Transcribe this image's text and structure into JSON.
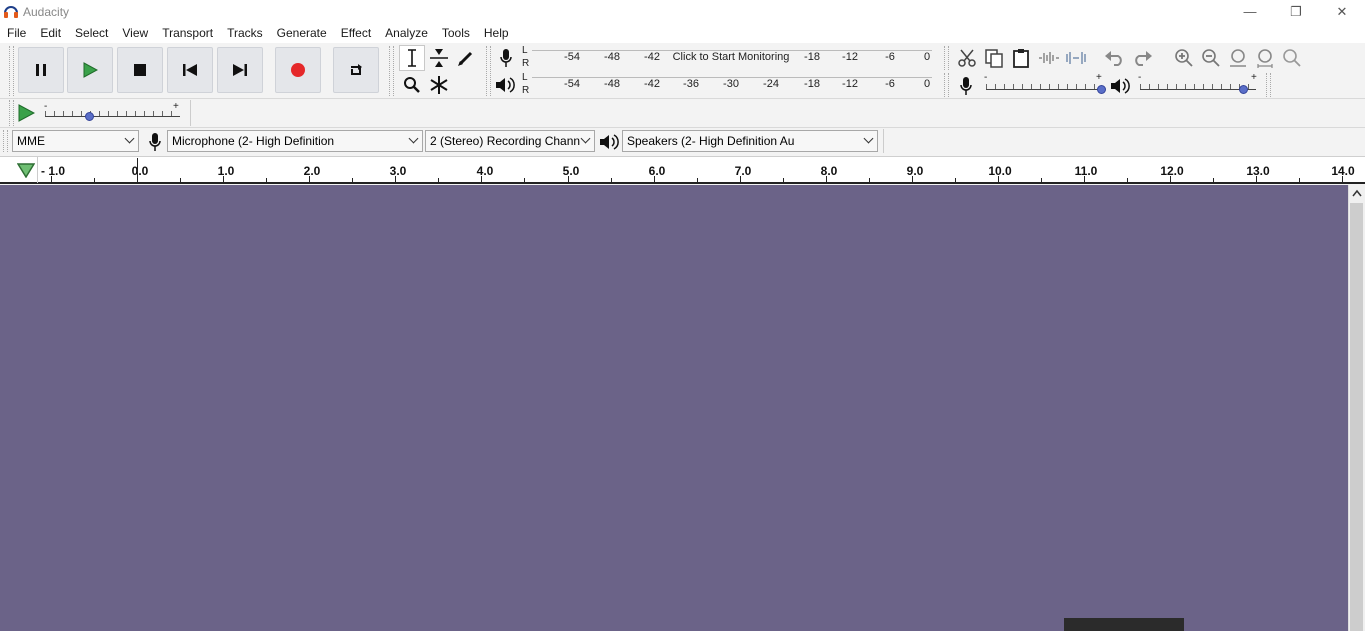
{
  "window": {
    "title": "Audacity",
    "minimize_glyph": "—",
    "maximize_glyph": "❐",
    "close_glyph": "✕"
  },
  "menu": [
    "File",
    "Edit",
    "Select",
    "View",
    "Transport",
    "Tracks",
    "Generate",
    "Effect",
    "Analyze",
    "Tools",
    "Help"
  ],
  "transport_buttons": [
    {
      "name": "pause-button",
      "icon": "pause-icon"
    },
    {
      "name": "play-button",
      "icon": "play-icon"
    },
    {
      "name": "stop-button",
      "icon": "stop-icon"
    },
    {
      "name": "skip-to-start-button",
      "icon": "skip-start-icon"
    },
    {
      "name": "skip-to-end-button",
      "icon": "skip-end-icon"
    },
    {
      "name": "record-button",
      "icon": "record-icon"
    },
    {
      "name": "loop-button",
      "icon": "loop-icon"
    }
  ],
  "tools": [
    "selection-tool",
    "envelope-tool",
    "draw-tool",
    "zoom-tool",
    "multi-tool"
  ],
  "record_meter": {
    "channels": [
      "L",
      "R"
    ],
    "scale": [
      "-54",
      "-48",
      "-42",
      "-18",
      "-12",
      "-6",
      "0"
    ],
    "monitor_label": "Click to Start Monitoring"
  },
  "play_meter": {
    "channels": [
      "L",
      "R"
    ],
    "scale": [
      "-54",
      "-48",
      "-42",
      "-36",
      "-30",
      "-24",
      "-18",
      "-12",
      "-6",
      "0"
    ]
  },
  "mixer": {
    "minus": "-",
    "plus": "+",
    "recording_volume": 1.0,
    "playback_volume": 0.9
  },
  "play_at_speed": {
    "minus": "-",
    "plus": "+",
    "speed": 0.33
  },
  "device_toolbar": {
    "host": "MME",
    "recording_device": "Microphone (2- High Definition",
    "channels": "2 (Stereo) Recording Chann",
    "playback_device": "Speakers (2- High Definition Au"
  },
  "timeline": {
    "labels": [
      "- 1.0",
      "0.0",
      "1.0",
      "2.0",
      "3.0",
      "4.0",
      "5.0",
      "6.0",
      "7.0",
      "8.0",
      "9.0",
      "10.0",
      "11.0",
      "12.0",
      "13.0",
      "14.0"
    ]
  },
  "colors": {
    "track_background": "#6b6388",
    "record_red": "#e5282a",
    "play_green": "#3aa14a",
    "meter_knob": "#5a6ec8"
  }
}
